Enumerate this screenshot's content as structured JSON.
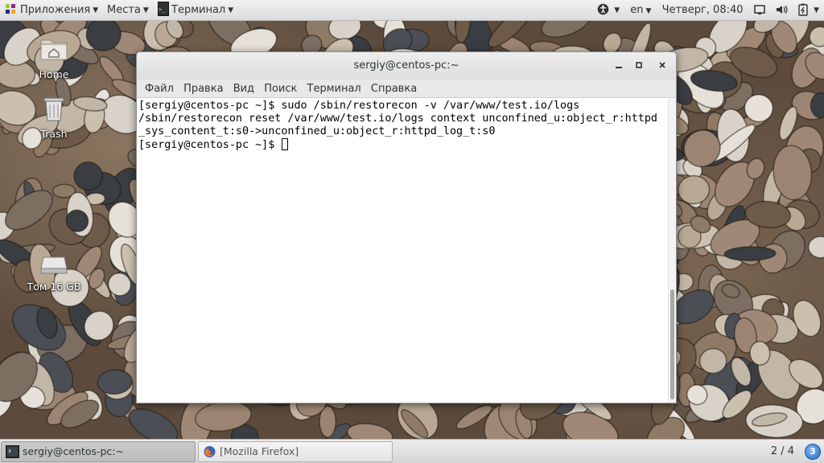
{
  "top_panel": {
    "applications_label": "Приложения",
    "places_label": "Места",
    "terminal_label": "Терминал",
    "language": "en",
    "clock": "Четверг, 08:40"
  },
  "desktop": {
    "icons": [
      {
        "label": "Home",
        "icon": "home-folder-icon"
      },
      {
        "label": "Trash",
        "icon": "trash-icon"
      },
      {
        "label": "Том 16 GB",
        "icon": "drive-icon"
      }
    ]
  },
  "terminal_window": {
    "title": "sergiy@centos-pc:~",
    "menu": [
      "Файл",
      "Правка",
      "Вид",
      "Поиск",
      "Терминал",
      "Справка"
    ],
    "lines": [
      "[sergiy@centos-pc ~]$ sudo /sbin/restorecon -v /var/www/test.io/logs",
      "/sbin/restorecon reset /var/www/test.io/logs context unconfined_u:object_r:httpd",
      "_sys_content_t:s0->unconfined_u:object_r:httpd_log_t:s0",
      "[sergiy@centos-pc ~]$ "
    ]
  },
  "taskbar": {
    "tasks": [
      {
        "label": "sergiy@centos-pc:~",
        "icon": "terminal-icon",
        "active": true
      },
      {
        "label": "[Mozilla Firefox]",
        "icon": "firefox-icon",
        "active": false
      }
    ],
    "workspace": "2 / 4",
    "notification_count": "3"
  },
  "colors": {
    "panel_bg": "#e6e6e6",
    "terminal_bg": "#ffffff",
    "text": "#2e3436",
    "badge_blue": "#2a6cc0"
  }
}
